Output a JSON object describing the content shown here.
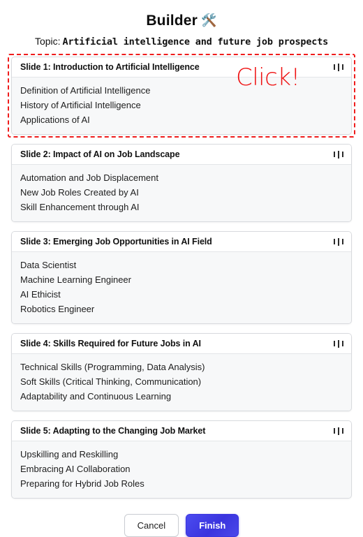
{
  "header": {
    "title": "Builder",
    "title_emoji": "🛠️",
    "topic_label": "Topic:",
    "topic_value": "Artificial intelligence and future job prospects"
  },
  "annotation": {
    "click_text": "Click!",
    "color": "#ef1010"
  },
  "theme": {
    "accent": "#3a34de",
    "highlight_border": "#ef1c1c",
    "card_border": "#d8dade",
    "card_body_bg": "#f7f8f9",
    "card_head_bg": "#ffffff"
  },
  "slides": [
    {
      "title": "Slide 1: Introduction to Artificial Intelligence",
      "selected": true,
      "drag_handle": "drag-handle-icon",
      "bullets": [
        "Definition of Artificial Intelligence",
        "History of Artificial Intelligence",
        "Applications of AI"
      ]
    },
    {
      "title": "Slide 2: Impact of AI on Job Landscape",
      "selected": false,
      "drag_handle": "drag-handle-icon",
      "bullets": [
        "Automation and Job Displacement",
        "New Job Roles Created by AI",
        "Skill Enhancement through AI"
      ]
    },
    {
      "title": "Slide 3: Emerging Job Opportunities in AI Field",
      "selected": false,
      "drag_handle": "drag-handle-icon",
      "bullets": [
        "Data Scientist",
        "Machine Learning Engineer",
        "AI Ethicist",
        "Robotics Engineer"
      ]
    },
    {
      "title": "Slide 4: Skills Required for Future Jobs in AI",
      "selected": false,
      "drag_handle": "drag-handle-icon",
      "bullets": [
        "Technical Skills (Programming, Data Analysis)",
        "Soft Skills (Critical Thinking, Communication)",
        "Adaptability and Continuous Learning"
      ]
    },
    {
      "title": "Slide 5: Adapting to the Changing Job Market",
      "selected": false,
      "drag_handle": "drag-handle-icon",
      "bullets": [
        "Upskilling and Reskilling",
        "Embracing AI Collaboration",
        "Preparing for Hybrid Job Roles"
      ]
    }
  ],
  "footer": {
    "cancel_label": "Cancel",
    "finish_label": "Finish"
  }
}
